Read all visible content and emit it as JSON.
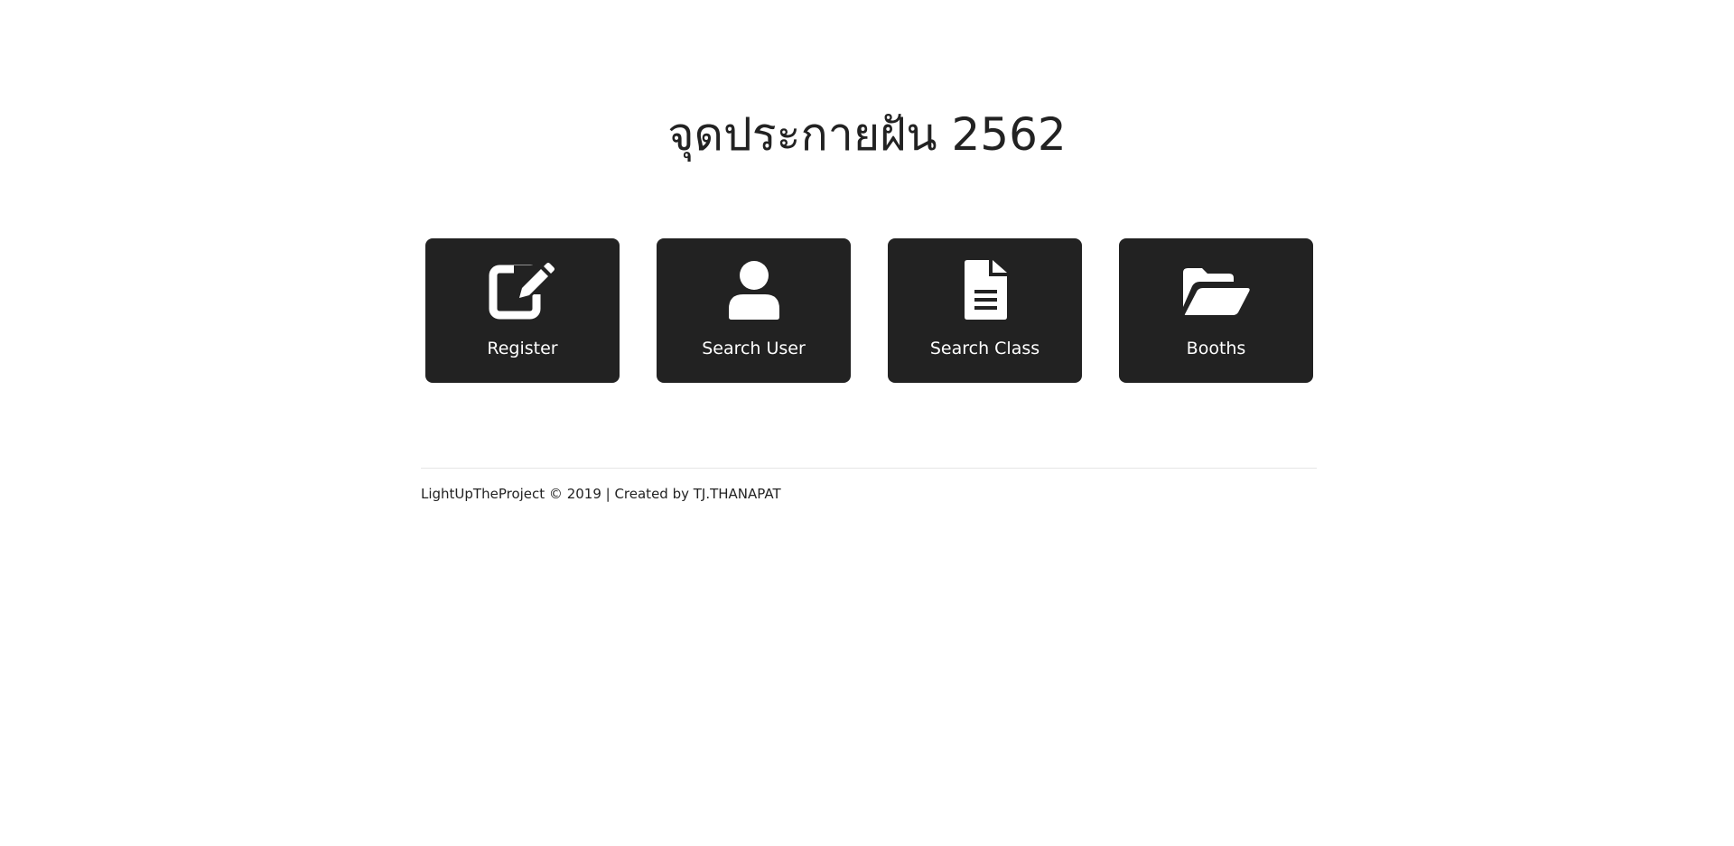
{
  "page": {
    "title": "จุดประกายฝัน 2562"
  },
  "menu": {
    "items": [
      {
        "label": "Register",
        "icon": "edit-icon"
      },
      {
        "label": "Search User",
        "icon": "user-icon"
      },
      {
        "label": "Search Class",
        "icon": "document-icon"
      },
      {
        "label": "Booths",
        "icon": "folder-open-icon"
      }
    ]
  },
  "footer": {
    "text": "LightUpTheProject © 2019 | Created by TJ.THANAPAT"
  },
  "colors": {
    "card_background": "#222222",
    "card_text": "#ffffff",
    "page_text": "#222222",
    "background": "#ffffff"
  }
}
